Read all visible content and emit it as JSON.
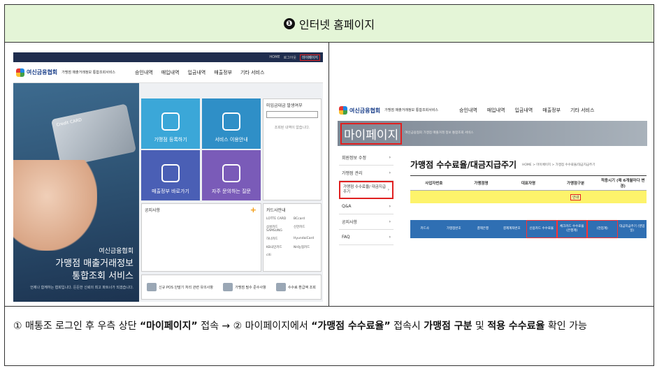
{
  "header": {
    "number": "❶",
    "title": "인터넷 홈페이지"
  },
  "left": {
    "topbar": [
      "HOME",
      "로그아웃",
      "마이페이지"
    ],
    "logo": "여신금융협회",
    "logo_sub": "가맹점 매출거래정보 통합조회서비스",
    "menu": [
      "승인내역",
      "매입내역",
      "입금내역",
      "매출정부",
      "기타 서비스"
    ],
    "card_text": "Credit CARD",
    "hero": {
      "line1": "여신금융협회",
      "line2": "가맹점 매출거래정보",
      "line3": "통합조회 서비스",
      "small": "언제나 함께하는 협회입니다. 든든한 신뢰의 최고 파트너가 되겠습니다."
    },
    "tiles": [
      "가맹점 등록하기",
      "서비스 이용안내",
      "매출정부 바로가기",
      "자주 문의하는 질문"
    ],
    "panel1": {
      "title": "미입금대금 발생여부",
      "msg": "조회된 내역이 없습니다."
    },
    "panel2": {
      "title": "공지사항",
      "plus": "+"
    },
    "panel3": {
      "title": "카드사안내",
      "banks": [
        "LOTTE CARD",
        "BCcard",
        "삼성카드 SAMSUNG",
        "신한카드",
        "하나카드",
        "HyundaiCard",
        "KB국민카드",
        "NH농협카드",
        "citi"
      ]
    },
    "bottom": [
      "신규 POS 단말기 처리 관련 유의사항",
      "가맹점 필수 준수사항",
      "수수료 환급액 조회"
    ]
  },
  "right": {
    "logo": "여신금융협회",
    "logo_sub": "가맹점 매출거래정보 통합조회서비스",
    "menu": [
      "승인내역",
      "매입내역",
      "입금내역",
      "매출정부",
      "기타 서비스"
    ],
    "banner": "마이페이지",
    "banner_sub": "여신금융협회 가맹점 매출거래 정보 통합조회 서비스",
    "sidebar": [
      "회원정보 수정",
      "가맹점 관리",
      "가맹점 수수료율/ 대금지급주기",
      "Q&A",
      "공지사항",
      "FAQ"
    ],
    "title": "가맹점 수수료율/대금지급주기",
    "breadcrumb": "HOME > 마이페이지 > 가맹점 수수료율/대금지급주기",
    "columns": [
      "사업자번호",
      "가맹점명",
      "대표자명",
      "가맹점구분",
      "적용시기 (매 6개월마다 변경)"
    ],
    "inquiry": "안내",
    "blue_cols": [
      "카드사",
      "가맹점번호",
      "결제은행",
      "결제계좌번호",
      "신용카드 수수료율",
      "체크카드 수수료율 (은행계)",
      "(전업계)",
      "대금지급주기 (영업일)"
    ]
  },
  "footer": {
    "p1": "① 매통조 로그인 후 우측 상단 ",
    "b1": "“마이페이지”",
    "p2": " 접속 → ② 마이페이지에서 ",
    "b2": "“가맹점 수수료율”",
    "p3": " 접속시 ",
    "b3": "가맹점 구분",
    "p4": " 및 ",
    "b4": "적용 수수료율",
    "p5": " 확인 가능"
  }
}
